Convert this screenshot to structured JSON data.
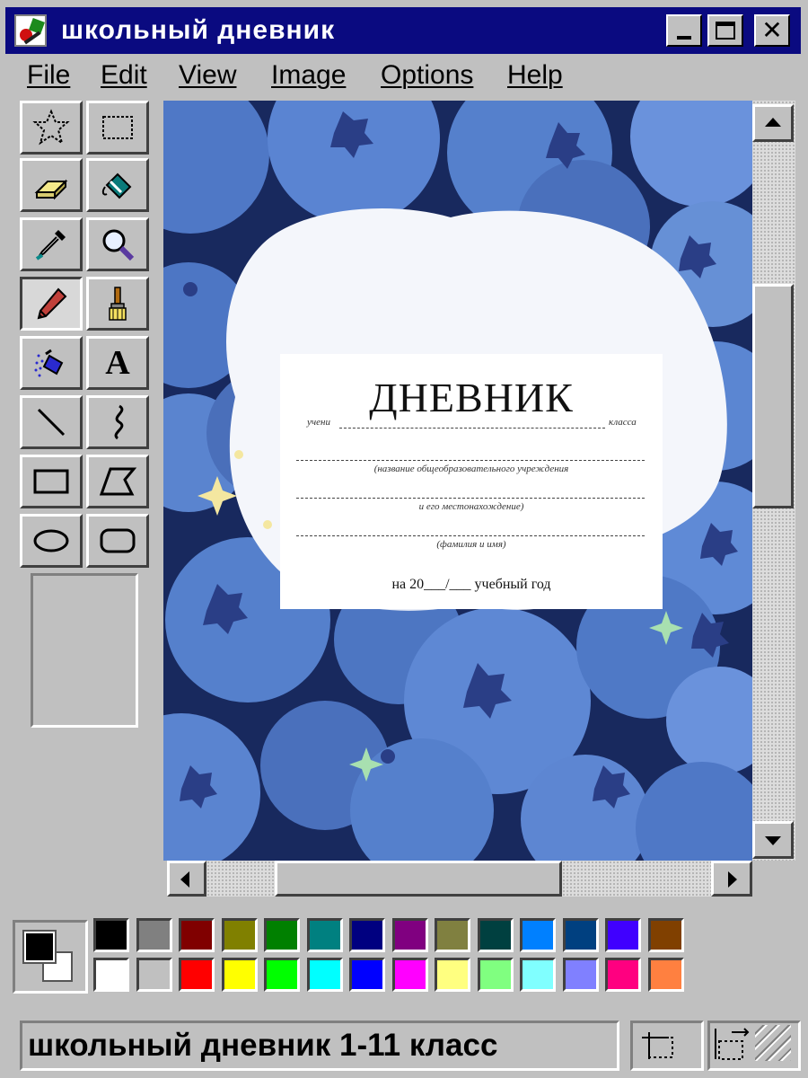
{
  "window": {
    "title": "школьный дневник",
    "controls": {
      "minimize": "minimize",
      "maximize": "maximize",
      "close": "✕"
    }
  },
  "menu": [
    "File",
    "Edit",
    "View",
    "Image",
    "Options",
    "Help"
  ],
  "tools": [
    {
      "name": "free-form-select-icon",
      "selected": false
    },
    {
      "name": "select-icon",
      "selected": false
    },
    {
      "name": "eraser-icon",
      "selected": false
    },
    {
      "name": "fill-bucket-icon",
      "selected": false
    },
    {
      "name": "eyedropper-icon",
      "selected": false
    },
    {
      "name": "magnifier-icon",
      "selected": false
    },
    {
      "name": "pencil-icon",
      "selected": true
    },
    {
      "name": "brush-icon",
      "selected": false
    },
    {
      "name": "airbrush-icon",
      "selected": false
    },
    {
      "name": "text-icon",
      "label": "A",
      "selected": false
    },
    {
      "name": "line-icon",
      "selected": false
    },
    {
      "name": "curve-icon",
      "selected": false
    },
    {
      "name": "rectangle-icon",
      "selected": false
    },
    {
      "name": "polygon-icon",
      "selected": false
    },
    {
      "name": "ellipse-icon",
      "selected": false
    },
    {
      "name": "rounded-rectangle-icon",
      "selected": false
    }
  ],
  "document": {
    "title": "ДНЕВНИК",
    "student_prefix": "учени",
    "class_suffix": "класса",
    "institution_caption": "(название общеобразовательного учреждения",
    "location_caption": "и его местонахождение)",
    "name_caption": "(фамилия и имя)",
    "year_line": "на 20___/___ учебный год"
  },
  "palette": {
    "foreground": "#000000",
    "background": "#ffffff",
    "row1": [
      "#000000",
      "#808080",
      "#800000",
      "#808000",
      "#008000",
      "#008080",
      "#000080",
      "#800080",
      "#808040",
      "#004040",
      "#0080ff",
      "#004080",
      "#4000ff",
      "#804000"
    ],
    "row2": [
      "#ffffff",
      "#c0c0c0",
      "#ff0000",
      "#ffff00",
      "#00ff00",
      "#00ffff",
      "#0000ff",
      "#ff00ff",
      "#ffff80",
      "#80ff80",
      "#80ffff",
      "#8080ff",
      "#ff0080",
      "#ff8040"
    ]
  },
  "status": {
    "text": "школьный дневник 1-11 класс"
  }
}
